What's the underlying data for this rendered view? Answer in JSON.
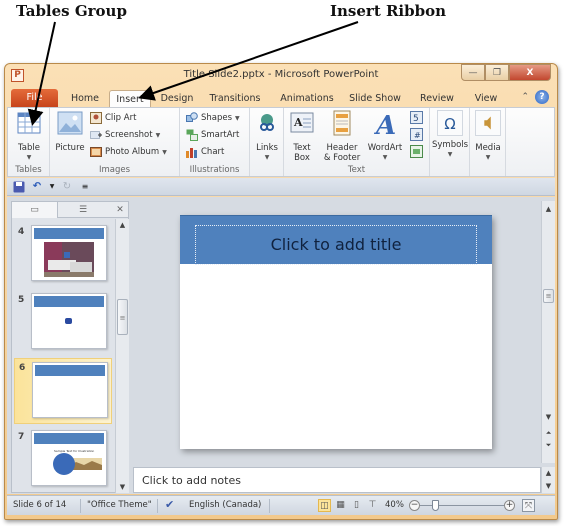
{
  "annotations": {
    "tables_group": "Tables Group",
    "insert_ribbon": "Insert Ribbon"
  },
  "window": {
    "app_icon": "P",
    "title": "Title Slide2.pptx - Microsoft PowerPoint",
    "minimize": "—",
    "restore": "❐",
    "close": "X"
  },
  "tabs": [
    {
      "label": "File"
    },
    {
      "label": "Home"
    },
    {
      "label": "Insert",
      "active": true
    },
    {
      "label": "Design"
    },
    {
      "label": "Transitions"
    },
    {
      "label": "Animations"
    },
    {
      "label": "Slide Show"
    },
    {
      "label": "Review"
    },
    {
      "label": "View"
    }
  ],
  "tab_right": {
    "minimize_ribbon": "⌃",
    "help": "?"
  },
  "ribbon": {
    "groups": {
      "tables": {
        "label": "Tables",
        "table_button": "Table",
        "dropdown": "▼"
      },
      "images": {
        "label": "Images",
        "picture_button": "Picture",
        "clip_art": "Clip Art",
        "screenshot": "Screenshot",
        "photo_album": "Photo Album"
      },
      "illustrations": {
        "label": "Illustrations",
        "shapes": "Shapes",
        "smartart": "SmartArt",
        "chart": "Chart"
      },
      "links": {
        "label": "",
        "links_button": "Links"
      },
      "text": {
        "label": "Text",
        "text_box_line1": "Text",
        "text_box_line2": "Box",
        "header_footer_line1": "Header",
        "header_footer_line2": "& Footer",
        "wordart": "WordArt"
      },
      "symbols": {
        "symbols_button": "Symbols",
        "symbol_glyph": "Ω"
      },
      "media": {
        "media_button": "Media"
      }
    }
  },
  "qat": {
    "save": "save",
    "undo": "undo",
    "redo": "redo",
    "customize": "customize"
  },
  "slides_panel": {
    "close": "✕",
    "thumbnails": [
      {
        "number": "4",
        "content": "photo"
      },
      {
        "number": "5",
        "content": "small-image"
      },
      {
        "number": "6",
        "content": "blank",
        "selected": true
      },
      {
        "number": "7",
        "content": "diagram",
        "text": "Sample Text for Illustration"
      }
    ]
  },
  "slide": {
    "title_placeholder": "Click to add title",
    "title_band_color": "#4f81bd"
  },
  "notes": {
    "placeholder": "Click to add notes"
  },
  "statusbar": {
    "slide_indicator": "Slide 6 of 14",
    "theme": "\"Office Theme\"",
    "language": "English (Canada)",
    "zoom_level": "40%",
    "zoom_out": "−",
    "zoom_in": "+"
  }
}
